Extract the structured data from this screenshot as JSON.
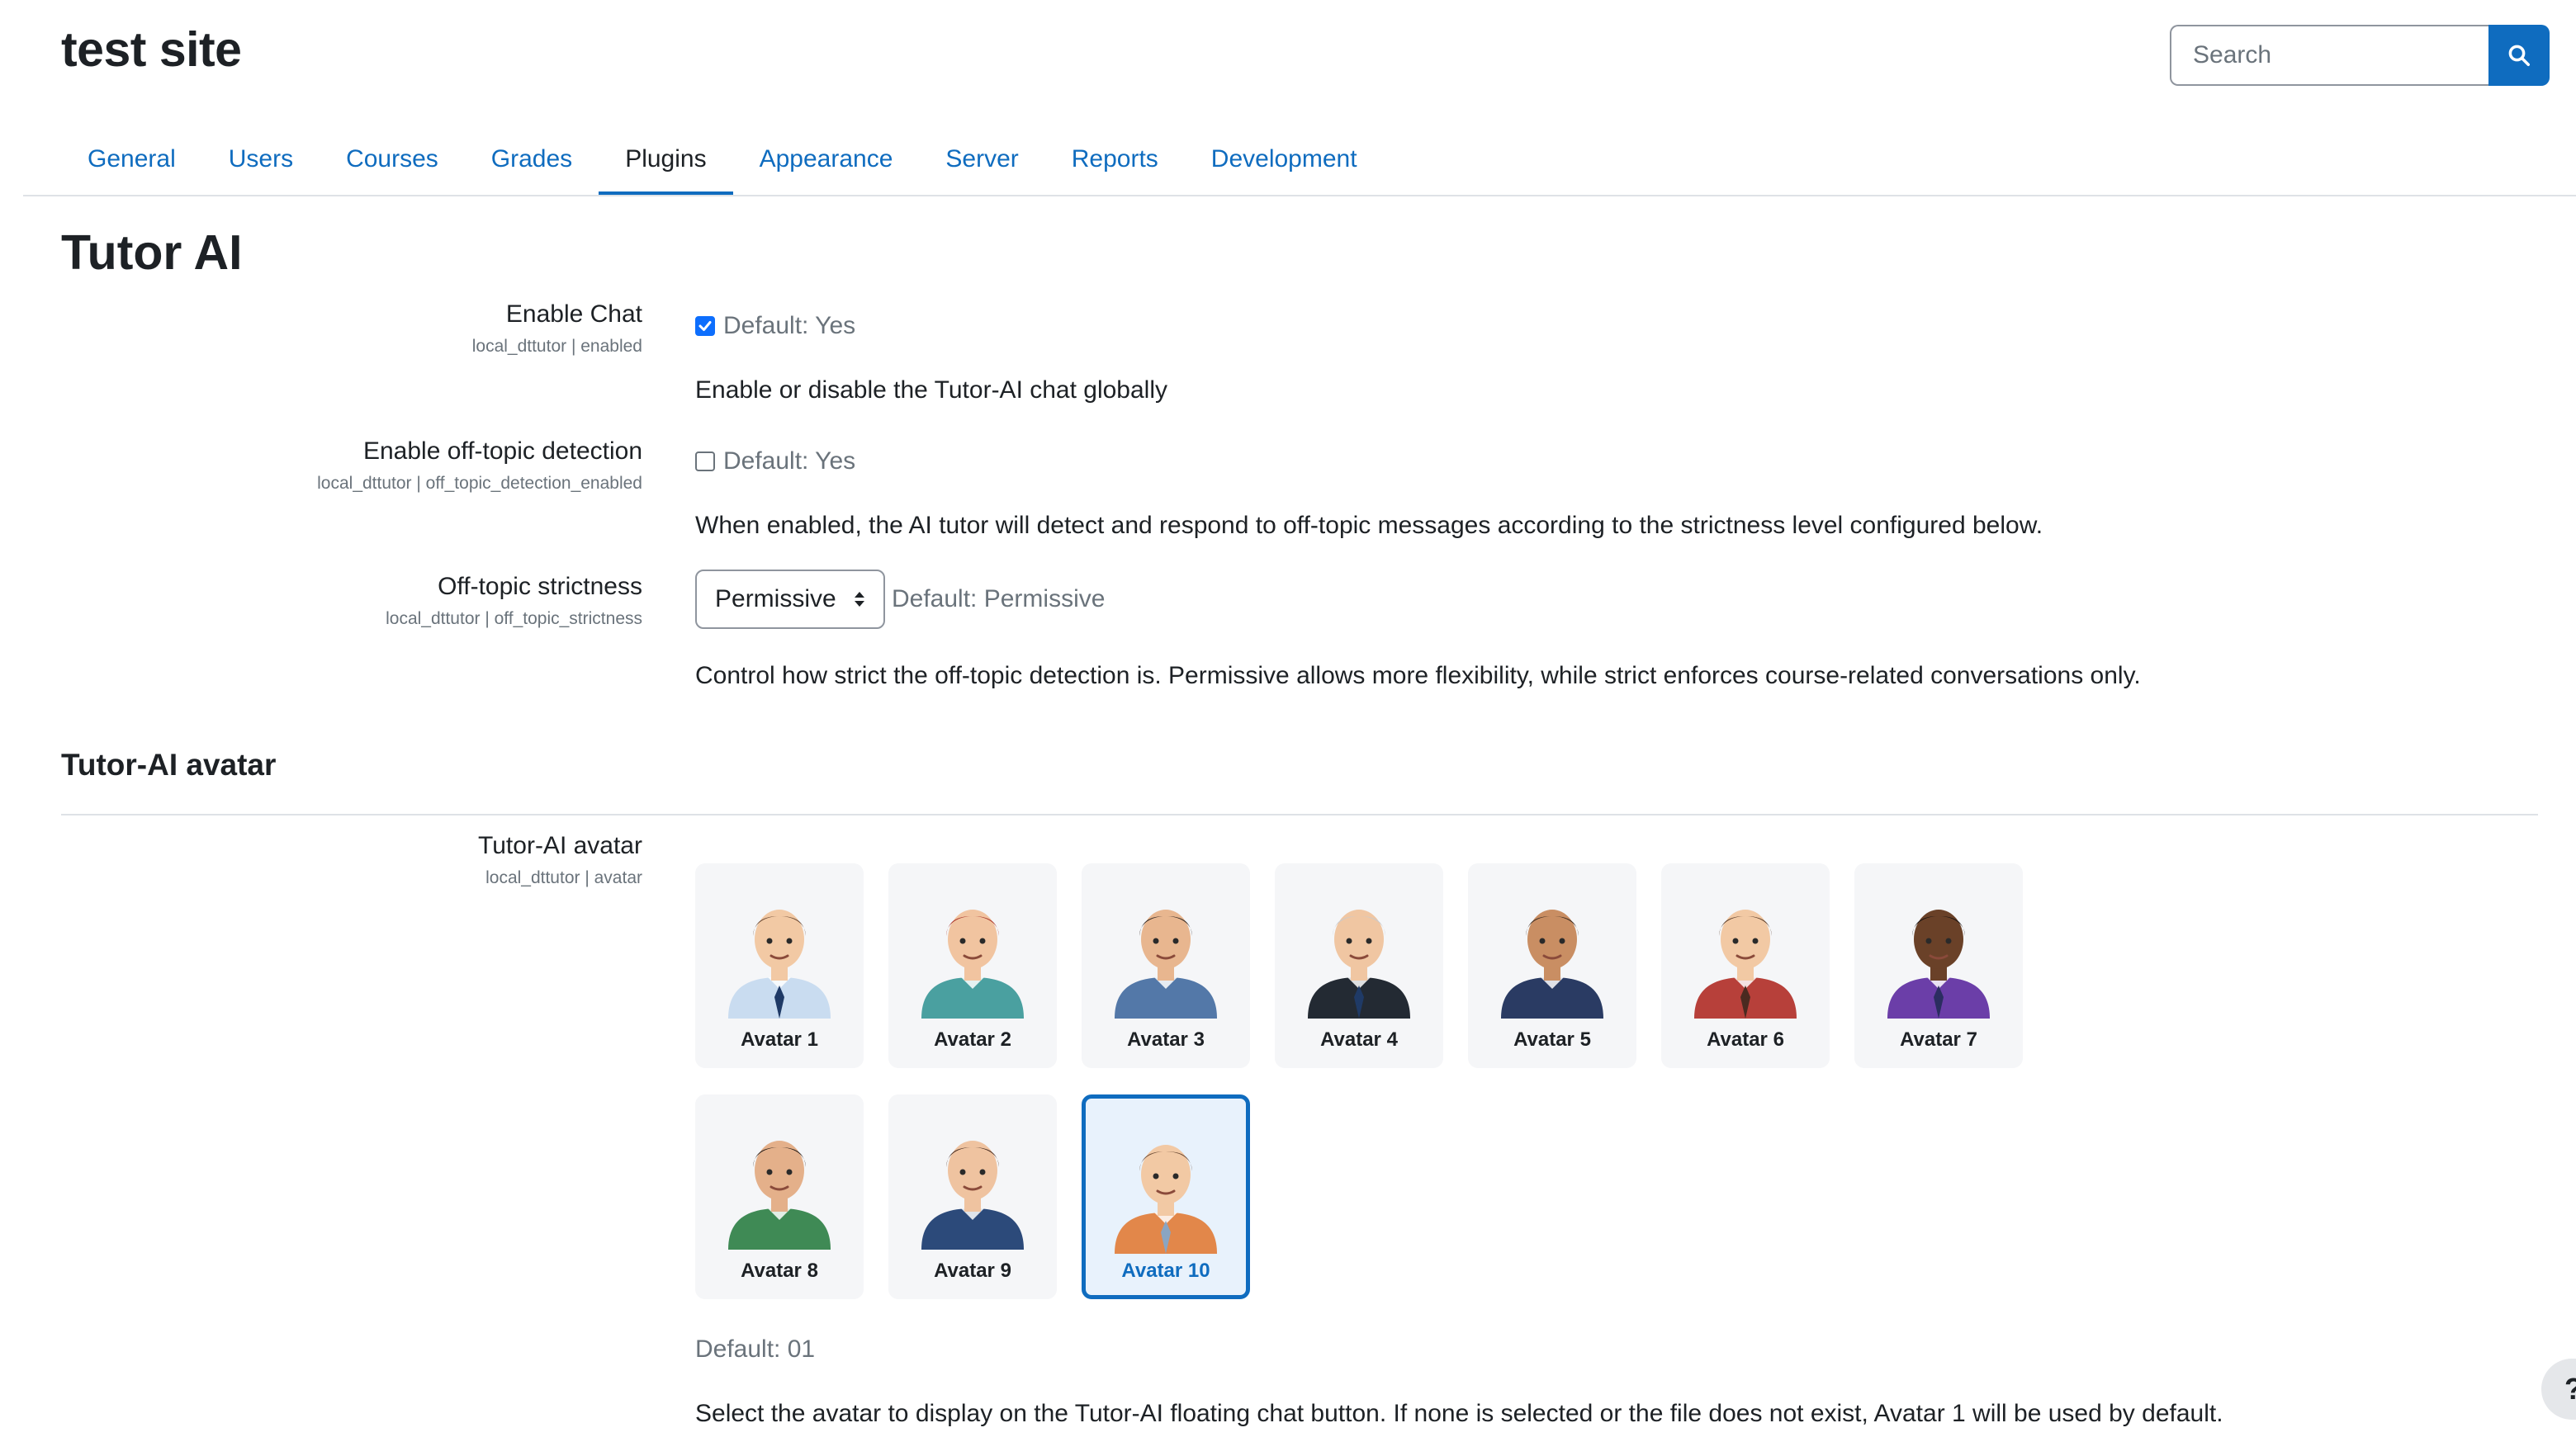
{
  "site": {
    "title": "test site"
  },
  "search": {
    "placeholder": "Search"
  },
  "tabs": [
    {
      "label": "General",
      "active": false
    },
    {
      "label": "Users",
      "active": false
    },
    {
      "label": "Courses",
      "active": false
    },
    {
      "label": "Grades",
      "active": false
    },
    {
      "label": "Plugins",
      "active": true
    },
    {
      "label": "Appearance",
      "active": false
    },
    {
      "label": "Server",
      "active": false
    },
    {
      "label": "Reports",
      "active": false
    },
    {
      "label": "Development",
      "active": false
    }
  ],
  "page": {
    "title": "Tutor AI"
  },
  "settings": {
    "enable_chat": {
      "label": "Enable Chat",
      "key": "local_dttutor | enabled",
      "checked": true,
      "default": "Default: Yes",
      "description": "Enable or disable the Tutor-AI chat globally"
    },
    "offtopic": {
      "label": "Enable off-topic detection",
      "key": "local_dttutor | off_topic_detection_enabled",
      "checked": false,
      "default": "Default: Yes",
      "description": "When enabled, the AI tutor will detect and respond to off-topic messages according to the strictness level configured below."
    },
    "strictness": {
      "label": "Off-topic strictness",
      "key": "local_dttutor | off_topic_strictness",
      "selected": "Permissive",
      "default": "Default: Permissive",
      "description": "Control how strict the off-topic detection is. Permissive allows more flexibility, while strict enforces course-related conversations only."
    },
    "avatar_section": {
      "heading": "Tutor-AI avatar"
    },
    "avatar": {
      "label": "Tutor-AI avatar",
      "key": "local_dttutor | avatar",
      "default": "Default: 01",
      "description": "Select the avatar to display on the Tutor-AI floating chat button. If none is selected or the file does not exist, Avatar 1 will be used by default.",
      "selected": "Avatar 10",
      "options": [
        {
          "label": "Avatar 1",
          "skin": "#f2c9a4",
          "hair": "#6b4a35",
          "shirt": "#c9dcf0",
          "tie": "#1f3a66"
        },
        {
          "label": "Avatar 2",
          "skin": "#f1c4a0",
          "hair": "#a8342a",
          "shirt": "#4aa0a0",
          "tie": ""
        },
        {
          "label": "Avatar 3",
          "skin": "#e8b68f",
          "hair": "#2d2420",
          "shirt": "#5378a8",
          "tie": ""
        },
        {
          "label": "Avatar 4",
          "skin": "#f0c6a2",
          "hair": "#c9cacc",
          "shirt": "#232a33",
          "tie": "#1f3a66"
        },
        {
          "label": "Avatar 5",
          "skin": "#c98e63",
          "hair": "#3b2a20",
          "shirt": "#2a3b63",
          "tie": ""
        },
        {
          "label": "Avatar 6",
          "skin": "#f2c9a4",
          "hair": "#5a3d2b",
          "shirt": "#b7403a",
          "tie": "#4a2a20"
        },
        {
          "label": "Avatar 7",
          "skin": "#6a4128",
          "hair": "#1a1412",
          "shirt": "#6b3ea8",
          "tie": "#2b2d60"
        },
        {
          "label": "Avatar 8",
          "skin": "#e4b08a",
          "hair": "#2b211c",
          "shirt": "#3f8a55",
          "tie": ""
        },
        {
          "label": "Avatar 9",
          "skin": "#efc3a0",
          "hair": "#4a2e22",
          "shirt": "#2c4a7a",
          "tie": ""
        },
        {
          "label": "Avatar 10",
          "skin": "#f2c9a4",
          "hair": "#6b4a35",
          "shirt": "#e2874a",
          "tie": "#8aa5c2"
        }
      ]
    }
  },
  "help": {
    "label": "?"
  }
}
